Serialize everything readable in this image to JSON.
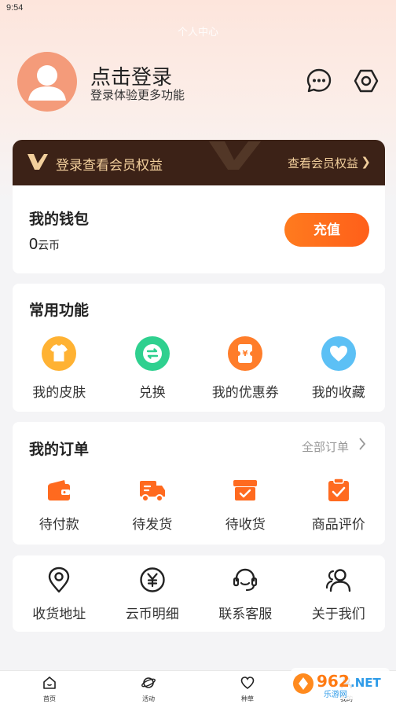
{
  "status_bar": {
    "time": "9:54"
  },
  "header": {
    "page_title": "个人中心",
    "login_title": "点击登录",
    "login_subtitle": "登录体验更多功能"
  },
  "vip": {
    "text": "登录查看会员权益",
    "link": "查看会员权益"
  },
  "wallet": {
    "title": "我的钱包",
    "amount": "0",
    "unit": "云币",
    "recharge_label": "充值"
  },
  "functions": {
    "title": "常用功能",
    "items": [
      {
        "label": "我的皮肤",
        "icon": "shirt-icon",
        "color": "#ffb233"
      },
      {
        "label": "兑换",
        "icon": "exchange-icon",
        "color": "#2fd08f"
      },
      {
        "label": "我的优惠券",
        "icon": "coupon-icon",
        "color": "#ff7d2a"
      },
      {
        "label": "我的收藏",
        "icon": "heart-icon",
        "color": "#5cc0f5"
      }
    ]
  },
  "orders": {
    "title": "我的订单",
    "all_label": "全部订单",
    "items": [
      {
        "label": "待付款",
        "icon": "wallet-icon"
      },
      {
        "label": "待发货",
        "icon": "truck-icon"
      },
      {
        "label": "待收货",
        "icon": "package-icon"
      },
      {
        "label": "商品评价",
        "icon": "clipboard-check-icon"
      }
    ],
    "accent": "#ff6a1f"
  },
  "misc": {
    "items": [
      {
        "label": "收货地址",
        "icon": "location-pin-icon"
      },
      {
        "label": "云币明细",
        "icon": "yen-coin-icon"
      },
      {
        "label": "联系客服",
        "icon": "headset-icon"
      },
      {
        "label": "关于我们",
        "icon": "users-icon"
      }
    ]
  },
  "bottom_nav": {
    "items": [
      {
        "label": "首页",
        "icon": "home-icon"
      },
      {
        "label": "活动",
        "icon": "planet-icon"
      },
      {
        "label": "种草",
        "icon": "heart-outline-icon"
      },
      {
        "label": "我的",
        "icon": "profile-icon"
      }
    ]
  },
  "watermark": {
    "logo_text": "962.NET",
    "sub_text": "乐游网"
  }
}
